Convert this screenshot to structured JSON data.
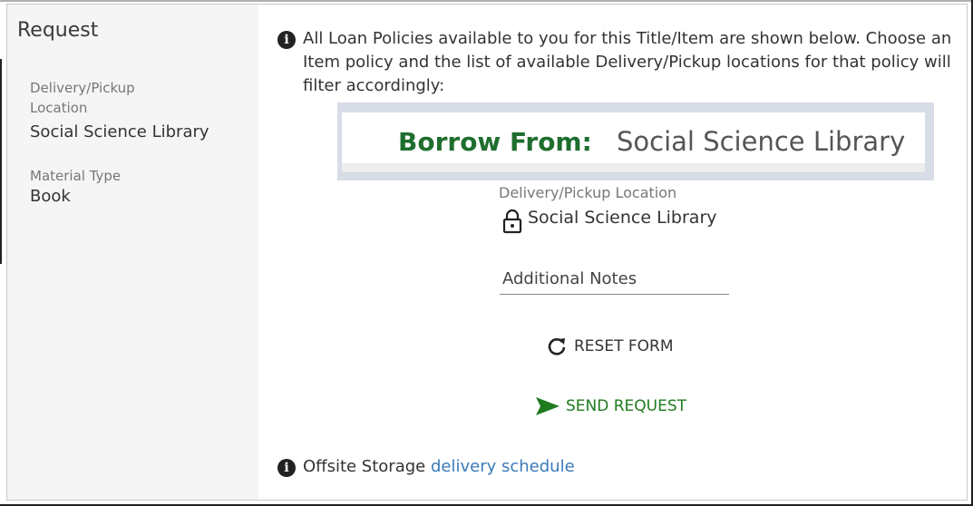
{
  "sidebar": {
    "title": "Request",
    "delivery_label": "Delivery/Pickup Location",
    "delivery_value": "Social Science Library",
    "material_label": "Material Type",
    "material_value": "Book"
  },
  "main": {
    "intro_text": "All Loan Policies available to you for this Title/Item are shown below. Choose an Item policy and the list of available Delivery/Pickup locations for that policy will filter accordingly:",
    "borrow_label": "Borrow From:",
    "borrow_value": "Social Science Library",
    "pickup_label": "Delivery/Pickup Location",
    "pickup_value": "Social Science Library",
    "notes_placeholder": "Additional Notes",
    "reset_label": "RESET FORM",
    "send_label": "SEND REQUEST",
    "footer_text": "Offsite Storage",
    "footer_link": "delivery schedule"
  },
  "icons": {
    "info": "info-icon",
    "lock": "lock-icon",
    "reset": "refresh-icon",
    "send": "send-icon"
  },
  "colors": {
    "accent_green": "#1e7b1e",
    "borrow_green": "#1f6e2e",
    "link_blue": "#3a7ab8",
    "sidebar_bg": "#f5f5f5"
  }
}
